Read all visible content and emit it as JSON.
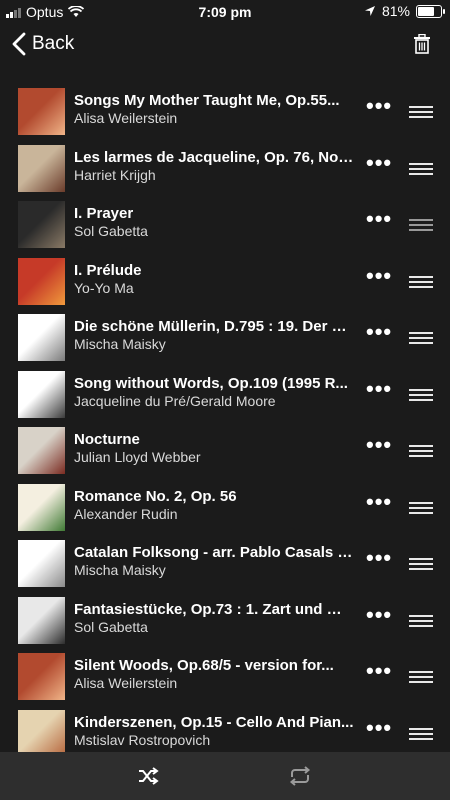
{
  "status_bar": {
    "carrier": "Optus",
    "time": "7:09 pm",
    "battery": "81%",
    "battery_level": 0.81
  },
  "nav": {
    "back_label": "Back"
  },
  "queue": [
    {
      "title": "Songs My Mother Taught Me, Op.55...",
      "artist": "Alisa Weilerstein",
      "art": [
        "#b24a2f",
        "#f0b488"
      ]
    },
    {
      "title": "Les larmes de Jacqueline, Op. 76, No....",
      "artist": "Harriet Krijgh",
      "art": [
        "#c9b59a",
        "#6a3b2a"
      ]
    },
    {
      "title": "I. Prayer",
      "artist": "Sol Gabetta",
      "art": [
        "#2a2a2a",
        "#8a7a66"
      ]
    },
    {
      "title": "I. Prélude",
      "artist": "Yo-Yo Ma",
      "art": [
        "#c63a28",
        "#f09a3c"
      ]
    },
    {
      "title": "Die schöne Müllerin, D.795 : 19. Der M...",
      "artist": "Mischa Maisky",
      "art": [
        "#ffffff",
        "#7a7a7a"
      ]
    },
    {
      "title": "Song without Words, Op.109 (1995 R...",
      "artist": "Jacqueline du Pré/Gerald Moore",
      "art": [
        "#ffffff",
        "#3a3a3a"
      ]
    },
    {
      "title": "Nocturne",
      "artist": "Julian Lloyd Webber",
      "art": [
        "#d8d2c8",
        "#7a2a20"
      ]
    },
    {
      "title": "Romance No. 2, Op. 56",
      "artist": "Alexander Rudin",
      "art": [
        "#f4efe0",
        "#3f7a34"
      ]
    },
    {
      "title": "Catalan Folksong - arr. Pablo Casals (...",
      "artist": "Mischa Maisky",
      "art": [
        "#ffffff",
        "#8a8a8a"
      ]
    },
    {
      "title": "Fantasiestücke, Op.73 : 1. Zart und mi...",
      "artist": "Sol Gabetta",
      "art": [
        "#e8e8e8",
        "#2c2c2c"
      ]
    },
    {
      "title": "Silent Woods, Op.68/5 - version for...",
      "artist": "Alisa Weilerstein",
      "art": [
        "#b24a2f",
        "#f0b488"
      ]
    },
    {
      "title": "Kinderszenen, Op.15 - Cello And Pian...",
      "artist": "Mstislav Rostropovich",
      "art": [
        "#e5d3b0",
        "#b5643a"
      ]
    }
  ],
  "icons": {
    "back": "chevron-left-icon",
    "trash": "trash-icon",
    "more": "more-icon",
    "drag": "drag-handle-icon",
    "shuffle": "shuffle-icon",
    "repeat": "repeat-icon"
  },
  "colors": {
    "background": "#1b1b1b",
    "toolbar": "#2e2e2e",
    "text": "#ffffff",
    "secondary": "#d9d9d9"
  }
}
